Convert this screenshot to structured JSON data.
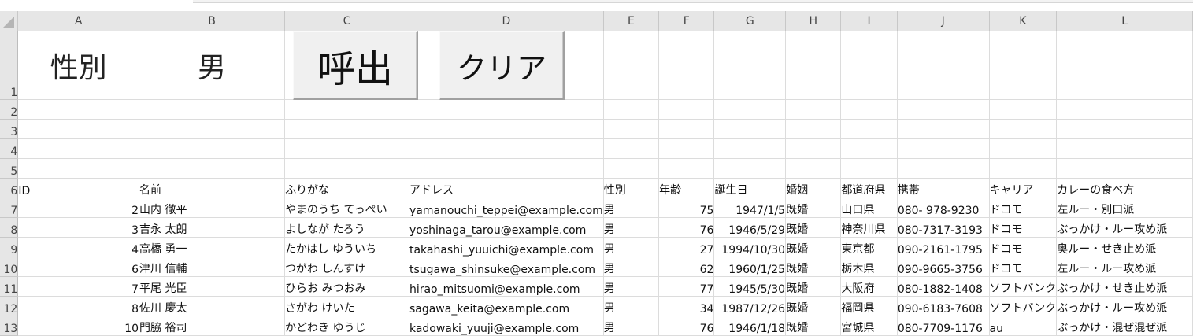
{
  "columns": [
    "A",
    "B",
    "C",
    "D",
    "E",
    "F",
    "G",
    "H",
    "I",
    "J",
    "K",
    "L"
  ],
  "top": {
    "gender_label": "性別",
    "gender_value": "男",
    "call_button": "呼出",
    "clear_button": "クリア"
  },
  "empty_rows": [
    "2",
    "3",
    "4",
    "5"
  ],
  "header": {
    "row": "6",
    "cells": [
      "ID",
      "名前",
      "ふりがな",
      "アドレス",
      "性別",
      "年齢",
      "誕生日",
      "婚姻",
      "都道府県",
      "携帯",
      "キャリア",
      "カレーの食べ方"
    ]
  },
  "rows": [
    {
      "row": "7",
      "id": "2",
      "name": "山内 徹平",
      "kana": "やまのうち てっぺい",
      "email": "yamanouchi_teppei@example.com",
      "gender": "男",
      "age": "75",
      "birthday": "1947/1/5",
      "marital": "既婚",
      "pref": "山口県",
      "mobile": "080- 978-9230",
      "carrier": "ドコモ",
      "curry": "左ルー・別口派"
    },
    {
      "row": "8",
      "id": "3",
      "name": "吉永 太朗",
      "kana": "よしなが たろう",
      "email": "yoshinaga_tarou@example.com",
      "gender": "男",
      "age": "76",
      "birthday": "1946/5/29",
      "marital": "既婚",
      "pref": "神奈川県",
      "mobile": "080-7317-3193",
      "carrier": "ドコモ",
      "curry": "ぶっかけ・ルー攻め派"
    },
    {
      "row": "9",
      "id": "4",
      "name": "高橋 勇一",
      "kana": "たかはし ゆういち",
      "email": "takahashi_yuuichi@example.com",
      "gender": "男",
      "age": "27",
      "birthday": "1994/10/30",
      "marital": "既婚",
      "pref": "東京都",
      "mobile": "090-2161-1795",
      "carrier": "ドコモ",
      "curry": "奥ルー・せき止め派"
    },
    {
      "row": "10",
      "id": "6",
      "name": "津川 信輔",
      "kana": "つがわ しんすけ",
      "email": "tsugawa_shinsuke@example.com",
      "gender": "男",
      "age": "62",
      "birthday": "1960/1/25",
      "marital": "既婚",
      "pref": "栃木県",
      "mobile": "090-9665-3756",
      "carrier": "ドコモ",
      "curry": "左ルー・ルー攻め派"
    },
    {
      "row": "11",
      "id": "7",
      "name": "平尾 光臣",
      "kana": "ひらお みつおみ",
      "email": "hirao_mitsuomi@example.com",
      "gender": "男",
      "age": "77",
      "birthday": "1945/5/30",
      "marital": "既婚",
      "pref": "大阪府",
      "mobile": "080-1882-1408",
      "carrier": "ソフトバンク",
      "curry": "ぶっかけ・せき止め派"
    },
    {
      "row": "12",
      "id": "8",
      "name": "佐川 慶太",
      "kana": "さがわ けいた",
      "email": "sagawa_keita@example.com",
      "gender": "男",
      "age": "34",
      "birthday": "1987/12/26",
      "marital": "既婚",
      "pref": "福岡県",
      "mobile": "090-6183-7608",
      "carrier": "ソフトバンク",
      "curry": "ぶっかけ・ルー攻め派"
    },
    {
      "row": "13",
      "id": "10",
      "name": "門脇 裕司",
      "kana": "かどわき ゆうじ",
      "email": "kadowaki_yuuji@example.com",
      "gender": "男",
      "age": "76",
      "birthday": "1946/1/18",
      "marital": "既婚",
      "pref": "宮城県",
      "mobile": "080-7709-1176",
      "carrier": "au",
      "curry": "ぶっかけ・混ぜ混ぜ派"
    }
  ]
}
